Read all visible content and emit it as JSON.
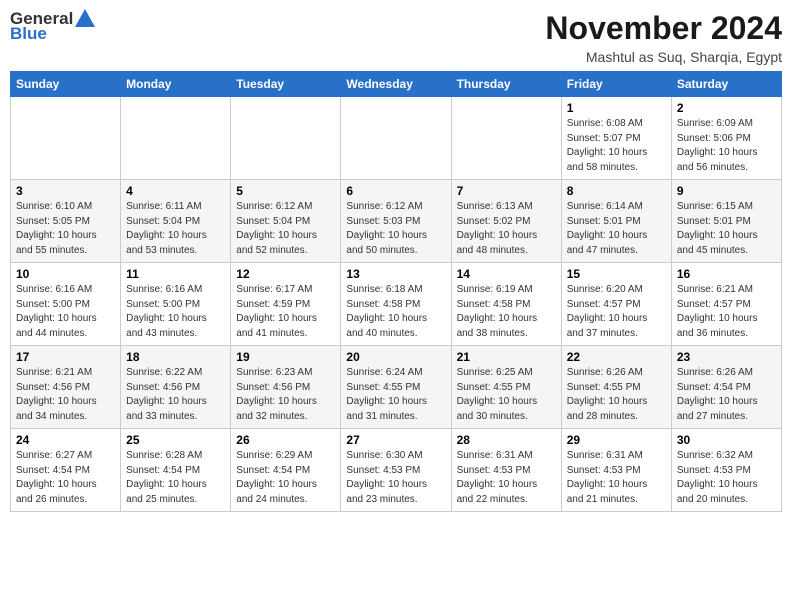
{
  "header": {
    "logo_general": "General",
    "logo_blue": "Blue",
    "month": "November 2024",
    "location": "Mashtul as Suq, Sharqia, Egypt"
  },
  "weekdays": [
    "Sunday",
    "Monday",
    "Tuesday",
    "Wednesday",
    "Thursday",
    "Friday",
    "Saturday"
  ],
  "weeks": [
    [
      {
        "day": "",
        "info": ""
      },
      {
        "day": "",
        "info": ""
      },
      {
        "day": "",
        "info": ""
      },
      {
        "day": "",
        "info": ""
      },
      {
        "day": "",
        "info": ""
      },
      {
        "day": "1",
        "info": "Sunrise: 6:08 AM\nSunset: 5:07 PM\nDaylight: 10 hours\nand 58 minutes."
      },
      {
        "day": "2",
        "info": "Sunrise: 6:09 AM\nSunset: 5:06 PM\nDaylight: 10 hours\nand 56 minutes."
      }
    ],
    [
      {
        "day": "3",
        "info": "Sunrise: 6:10 AM\nSunset: 5:05 PM\nDaylight: 10 hours\nand 55 minutes."
      },
      {
        "day": "4",
        "info": "Sunrise: 6:11 AM\nSunset: 5:04 PM\nDaylight: 10 hours\nand 53 minutes."
      },
      {
        "day": "5",
        "info": "Sunrise: 6:12 AM\nSunset: 5:04 PM\nDaylight: 10 hours\nand 52 minutes."
      },
      {
        "day": "6",
        "info": "Sunrise: 6:12 AM\nSunset: 5:03 PM\nDaylight: 10 hours\nand 50 minutes."
      },
      {
        "day": "7",
        "info": "Sunrise: 6:13 AM\nSunset: 5:02 PM\nDaylight: 10 hours\nand 48 minutes."
      },
      {
        "day": "8",
        "info": "Sunrise: 6:14 AM\nSunset: 5:01 PM\nDaylight: 10 hours\nand 47 minutes."
      },
      {
        "day": "9",
        "info": "Sunrise: 6:15 AM\nSunset: 5:01 PM\nDaylight: 10 hours\nand 45 minutes."
      }
    ],
    [
      {
        "day": "10",
        "info": "Sunrise: 6:16 AM\nSunset: 5:00 PM\nDaylight: 10 hours\nand 44 minutes."
      },
      {
        "day": "11",
        "info": "Sunrise: 6:16 AM\nSunset: 5:00 PM\nDaylight: 10 hours\nand 43 minutes."
      },
      {
        "day": "12",
        "info": "Sunrise: 6:17 AM\nSunset: 4:59 PM\nDaylight: 10 hours\nand 41 minutes."
      },
      {
        "day": "13",
        "info": "Sunrise: 6:18 AM\nSunset: 4:58 PM\nDaylight: 10 hours\nand 40 minutes."
      },
      {
        "day": "14",
        "info": "Sunrise: 6:19 AM\nSunset: 4:58 PM\nDaylight: 10 hours\nand 38 minutes."
      },
      {
        "day": "15",
        "info": "Sunrise: 6:20 AM\nSunset: 4:57 PM\nDaylight: 10 hours\nand 37 minutes."
      },
      {
        "day": "16",
        "info": "Sunrise: 6:21 AM\nSunset: 4:57 PM\nDaylight: 10 hours\nand 36 minutes."
      }
    ],
    [
      {
        "day": "17",
        "info": "Sunrise: 6:21 AM\nSunset: 4:56 PM\nDaylight: 10 hours\nand 34 minutes."
      },
      {
        "day": "18",
        "info": "Sunrise: 6:22 AM\nSunset: 4:56 PM\nDaylight: 10 hours\nand 33 minutes."
      },
      {
        "day": "19",
        "info": "Sunrise: 6:23 AM\nSunset: 4:56 PM\nDaylight: 10 hours\nand 32 minutes."
      },
      {
        "day": "20",
        "info": "Sunrise: 6:24 AM\nSunset: 4:55 PM\nDaylight: 10 hours\nand 31 minutes."
      },
      {
        "day": "21",
        "info": "Sunrise: 6:25 AM\nSunset: 4:55 PM\nDaylight: 10 hours\nand 30 minutes."
      },
      {
        "day": "22",
        "info": "Sunrise: 6:26 AM\nSunset: 4:55 PM\nDaylight: 10 hours\nand 28 minutes."
      },
      {
        "day": "23",
        "info": "Sunrise: 6:26 AM\nSunset: 4:54 PM\nDaylight: 10 hours\nand 27 minutes."
      }
    ],
    [
      {
        "day": "24",
        "info": "Sunrise: 6:27 AM\nSunset: 4:54 PM\nDaylight: 10 hours\nand 26 minutes."
      },
      {
        "day": "25",
        "info": "Sunrise: 6:28 AM\nSunset: 4:54 PM\nDaylight: 10 hours\nand 25 minutes."
      },
      {
        "day": "26",
        "info": "Sunrise: 6:29 AM\nSunset: 4:54 PM\nDaylight: 10 hours\nand 24 minutes."
      },
      {
        "day": "27",
        "info": "Sunrise: 6:30 AM\nSunset: 4:53 PM\nDaylight: 10 hours\nand 23 minutes."
      },
      {
        "day": "28",
        "info": "Sunrise: 6:31 AM\nSunset: 4:53 PM\nDaylight: 10 hours\nand 22 minutes."
      },
      {
        "day": "29",
        "info": "Sunrise: 6:31 AM\nSunset: 4:53 PM\nDaylight: 10 hours\nand 21 minutes."
      },
      {
        "day": "30",
        "info": "Sunrise: 6:32 AM\nSunset: 4:53 PM\nDaylight: 10 hours\nand 20 minutes."
      }
    ]
  ]
}
